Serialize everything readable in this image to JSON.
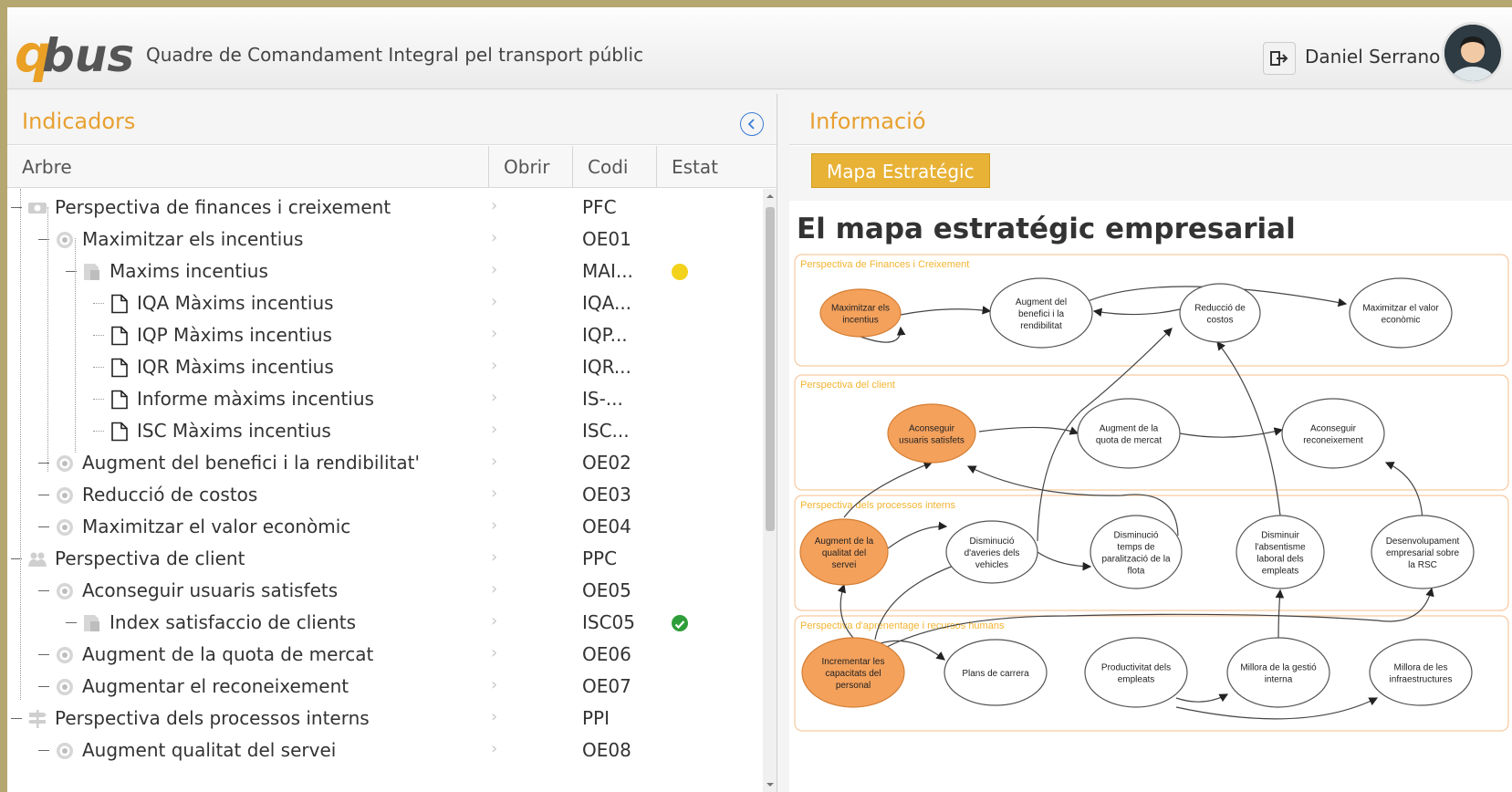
{
  "app": {
    "logo_text": "qbus",
    "title": "Quadre de Comandament Integral pel transport públic",
    "user_name": "Daniel Serrano"
  },
  "left_panel": {
    "title": "Indicadors",
    "columns": [
      "Arbre",
      "Obrir",
      "Codi",
      "Estat"
    ],
    "rows": [
      {
        "label": "Perspectiva de finances i creixement",
        "code": "PFC",
        "icon": "money-icon",
        "level": 0,
        "status": ""
      },
      {
        "label": "Maximitzar els incentius",
        "code": "OE01",
        "icon": "target-icon",
        "level": 1,
        "status": ""
      },
      {
        "label": "Maxims incentius",
        "code": "MAI...",
        "icon": "indicator-icon",
        "level": 2,
        "status": "warning"
      },
      {
        "label": "IQA Màxims incentius",
        "code": "IQA...",
        "icon": "document-icon",
        "level": 3,
        "status": ""
      },
      {
        "label": "IQP Màxims incentius",
        "code": "IQP...",
        "icon": "document-icon",
        "level": 3,
        "status": ""
      },
      {
        "label": "IQR Màxims incentius",
        "code": "IQR...",
        "icon": "document-icon",
        "level": 3,
        "status": ""
      },
      {
        "label": "Informe màxims incentius",
        "code": "IS-...",
        "icon": "document-icon",
        "level": 3,
        "status": ""
      },
      {
        "label": "ISC Màxims incentius",
        "code": "ISC...",
        "icon": "document-icon",
        "level": 3,
        "status": ""
      },
      {
        "label": "Augment del benefici i la rendibilitat'",
        "code": "OE02",
        "icon": "target-icon",
        "level": 1,
        "status": ""
      },
      {
        "label": "Reducció de costos",
        "code": "OE03",
        "icon": "target-icon",
        "level": 1,
        "status": ""
      },
      {
        "label": "Maximitzar el valor econòmic",
        "code": "OE04",
        "icon": "target-icon",
        "level": 1,
        "status": ""
      },
      {
        "label": "Perspectiva de client",
        "code": "PPC",
        "icon": "users-icon",
        "level": 0,
        "status": ""
      },
      {
        "label": "Aconseguir usuaris satisfets",
        "code": "OE05",
        "icon": "target-icon",
        "level": 1,
        "status": ""
      },
      {
        "label": "Index satisfaccio de clients",
        "code": "ISC05",
        "icon": "indicator-icon",
        "level": 2,
        "status": "ok"
      },
      {
        "label": "Augment de la quota de mercat",
        "code": "OE06",
        "icon": "target-icon",
        "level": 1,
        "status": ""
      },
      {
        "label": "Augmentar el reconeixement",
        "code": "OE07",
        "icon": "target-icon",
        "level": 1,
        "status": ""
      },
      {
        "label": "Perspectiva dels processos interns",
        "code": "PPI",
        "icon": "signpost-icon",
        "level": 0,
        "status": ""
      },
      {
        "label": "Augment qualitat del servei",
        "code": "OE08",
        "icon": "target-icon",
        "level": 1,
        "status": ""
      }
    ]
  },
  "right_panel": {
    "title": "Informació",
    "button_label": "Mapa Estratégic",
    "heading": "El mapa estratégic empresarial",
    "map": {
      "perspectives": [
        "Perspectiva de Finances i Creixement",
        "Perspectiva del client",
        "Perspectiva dels processos interns",
        "Perspectiva d'aprenentage i recursos humans"
      ],
      "nodes": [
        {
          "id": "n1",
          "lines": [
            "Maximitzar els",
            "incentius"
          ],
          "highlight": true
        },
        {
          "id": "n2",
          "lines": [
            "Augment del",
            "benefici i la",
            "rendibilitat"
          ],
          "highlight": false
        },
        {
          "id": "n3",
          "lines": [
            "Reducció de",
            "costos"
          ],
          "highlight": false
        },
        {
          "id": "n4",
          "lines": [
            "Maximitzar el valor",
            "econòmic"
          ],
          "highlight": false
        },
        {
          "id": "n5",
          "lines": [
            "Aconseguir",
            "usuaris satisfets"
          ],
          "highlight": true
        },
        {
          "id": "n6",
          "lines": [
            "Augment de la",
            "quota de mercat"
          ],
          "highlight": false
        },
        {
          "id": "n7",
          "lines": [
            "Aconseguir",
            "reconeixement"
          ],
          "highlight": false
        },
        {
          "id": "n8",
          "lines": [
            "Augment de la",
            "qualitat del",
            "servei"
          ],
          "highlight": true
        },
        {
          "id": "n9",
          "lines": [
            "Disminució",
            "d'averies dels",
            "vehicles"
          ],
          "highlight": false
        },
        {
          "id": "n10",
          "lines": [
            "Disminució",
            "temps de",
            "paralització de la",
            "flota"
          ],
          "highlight": false
        },
        {
          "id": "n11",
          "lines": [
            "Disminuir",
            "l'absentisme",
            "laboral dels",
            "empleats"
          ],
          "highlight": false
        },
        {
          "id": "n12",
          "lines": [
            "Desenvolupament",
            "empresarial sobre",
            "la RSC"
          ],
          "highlight": false
        },
        {
          "id": "n13",
          "lines": [
            "Incrementar les",
            "capacitats del",
            "personal"
          ],
          "highlight": true
        },
        {
          "id": "n14",
          "lines": [
            "Plans de carrera"
          ],
          "highlight": false
        },
        {
          "id": "n15",
          "lines": [
            "Productivitat dels",
            "empleats"
          ],
          "highlight": false
        },
        {
          "id": "n16",
          "lines": [
            "Millora de la gestió",
            "interna"
          ],
          "highlight": false
        },
        {
          "id": "n17",
          "lines": [
            "Millora de les",
            "infraestructures"
          ],
          "highlight": false
        }
      ]
    }
  },
  "colors": {
    "accent": "#e8a030",
    "button": "#e8b236",
    "node_highlight": "#f4a15c",
    "status_warning": "#f2d21b",
    "status_ok": "#2e9e3a"
  }
}
